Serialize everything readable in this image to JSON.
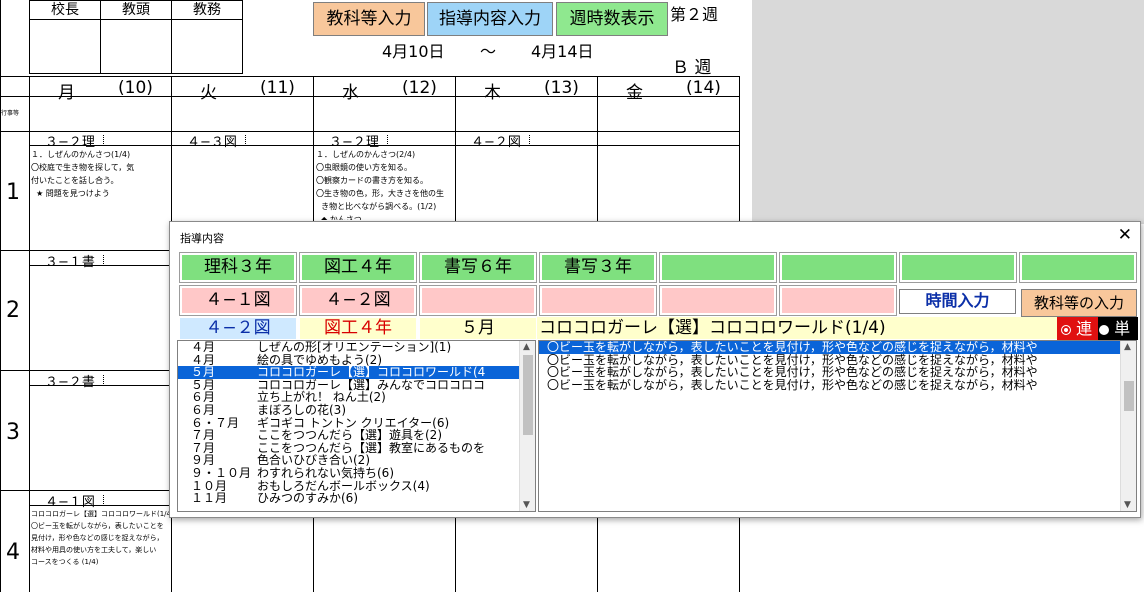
{
  "stamps": [
    {
      "label": "校長"
    },
    {
      "label": "教頭"
    },
    {
      "label": "教務"
    }
  ],
  "buttons": {
    "kyouka": "教科等入力",
    "shidou": "指導内容入力",
    "shuji": "週時数表示"
  },
  "week_label": "第２週",
  "range": {
    "start": "4月10日",
    "sep": "〜",
    "end": "4月14日"
  },
  "b_week": "Ｂ 週",
  "gyouji_label": "行事等",
  "days": [
    {
      "name": "月",
      "num": "(10)"
    },
    {
      "name": "火",
      "num": "(11)"
    },
    {
      "name": "水",
      "num": "(12)"
    },
    {
      "name": "木",
      "num": "(13)"
    },
    {
      "name": "金",
      "num": "(14)"
    }
  ],
  "periods": [
    "1",
    "2",
    "3",
    "4"
  ],
  "cells": {
    "p1_mon": "３−２理",
    "p1_tue": "４−３図",
    "p1_wed": "３−２理",
    "p1_thu": "４−２図",
    "p2_mon": "３−１書",
    "p3_mon": "３−２書",
    "p4_mon": "４−１図"
  },
  "notes": {
    "p1_mon": "１．しぜんのかんさつ(1/4)\n〇校庭で生き物を探して，気\n付いたことを話し合う。\n  ★ 問題を見つけよう",
    "p1_wed": "１．しぜんのかんさつ(2/4)\n〇虫眼鏡の使い方を知る。\n〇観察カードの書き方を知る。\n〇生き物の色，形，大きさを他の生\n  き物と比べながら調べる。(1/2)\n  ◆ かんさつ",
    "p4_mon": "コロコロガーレ【選】コロコロワールド(1/4)\n〇ビー玉を転がしながら，表したいことを\n見付け，形や色などの感じを捉えながら，\n材料や用具の使い方を工夫して，楽しい\nコースをつくる (1/4)"
  },
  "dialog": {
    "title": "指導内容",
    "close": "✕",
    "tabs_row1": [
      "理科３年",
      "図工４年",
      "書写６年",
      "書写３年",
      "",
      "",
      "",
      ""
    ],
    "tabs_row2": [
      "４−１図",
      "４−２図",
      "",
      "",
      "",
      ""
    ],
    "time_input": "時間入力",
    "kyouka_input": "教科等の入力",
    "class_label": "４−２図",
    "subject_label": "図工４年",
    "month_label": "５月",
    "unit_title": "コロコロガーレ【選】コロコロワールド(1/4)",
    "radio_ren": "連",
    "radio_tan": "単",
    "units": [
      {
        "m": "４月",
        "t": "しぜんの形[オリエンテーション](1)"
      },
      {
        "m": "４月",
        "t": "絵の具でゆめもよう(2)"
      },
      {
        "m": "５月",
        "t": "コロコロガーレ【選】コロコロワールド(4"
      },
      {
        "m": "５月",
        "t": "コロコロガーレ【選】みんなでコロコロコ"
      },
      {
        "m": "６月",
        "t": "立ち上がれ！ ねん土(2)"
      },
      {
        "m": "６月",
        "t": "まぼろしの花(3)"
      },
      {
        "m": "６・７月",
        "t": "ギコギコ トントン クリエイター(6)"
      },
      {
        "m": "７月",
        "t": "ここをつつんだら【選】遊具を(2)"
      },
      {
        "m": "７月",
        "t": "ここをつつんだら【選】教室にあるものを"
      },
      {
        "m": "９月",
        "t": "色合いひびき合い(2)"
      },
      {
        "m": "９・１０月",
        "t": "わすれられない気持ち(6)"
      },
      {
        "m": "１０月",
        "t": "おもしろだんボールボックス(4)"
      },
      {
        "m": "１１月",
        "t": "ひみつのすみか(6)"
      }
    ],
    "contents": [
      "〇ビー玉を転がしながら，表したいことを見付け，形や色などの感じを捉えながら，材料や",
      "〇ビー玉を転がしながら，表したいことを見付け，形や色などの感じを捉えながら，材料や",
      "〇ビー玉を転がしながら，表したいことを見付け，形や色などの感じを捉えながら，材料や",
      "〇ビー玉を転がしながら，表したいことを見付け，形や色などの感じを捉えながら，材料や"
    ]
  },
  "colors": {
    "btn_kyouka": "#f8c79b",
    "btn_shidou": "#9ed4f7",
    "btn_shuji": "#8fe88f",
    "tab_green": "#7fe07f",
    "tab_pink": "#ffc8c8",
    "label_blue": "#cfe9ff",
    "label_yellow": "#ffffcc",
    "select_blue": "#0a64d8",
    "radio_red": "#e01010"
  }
}
